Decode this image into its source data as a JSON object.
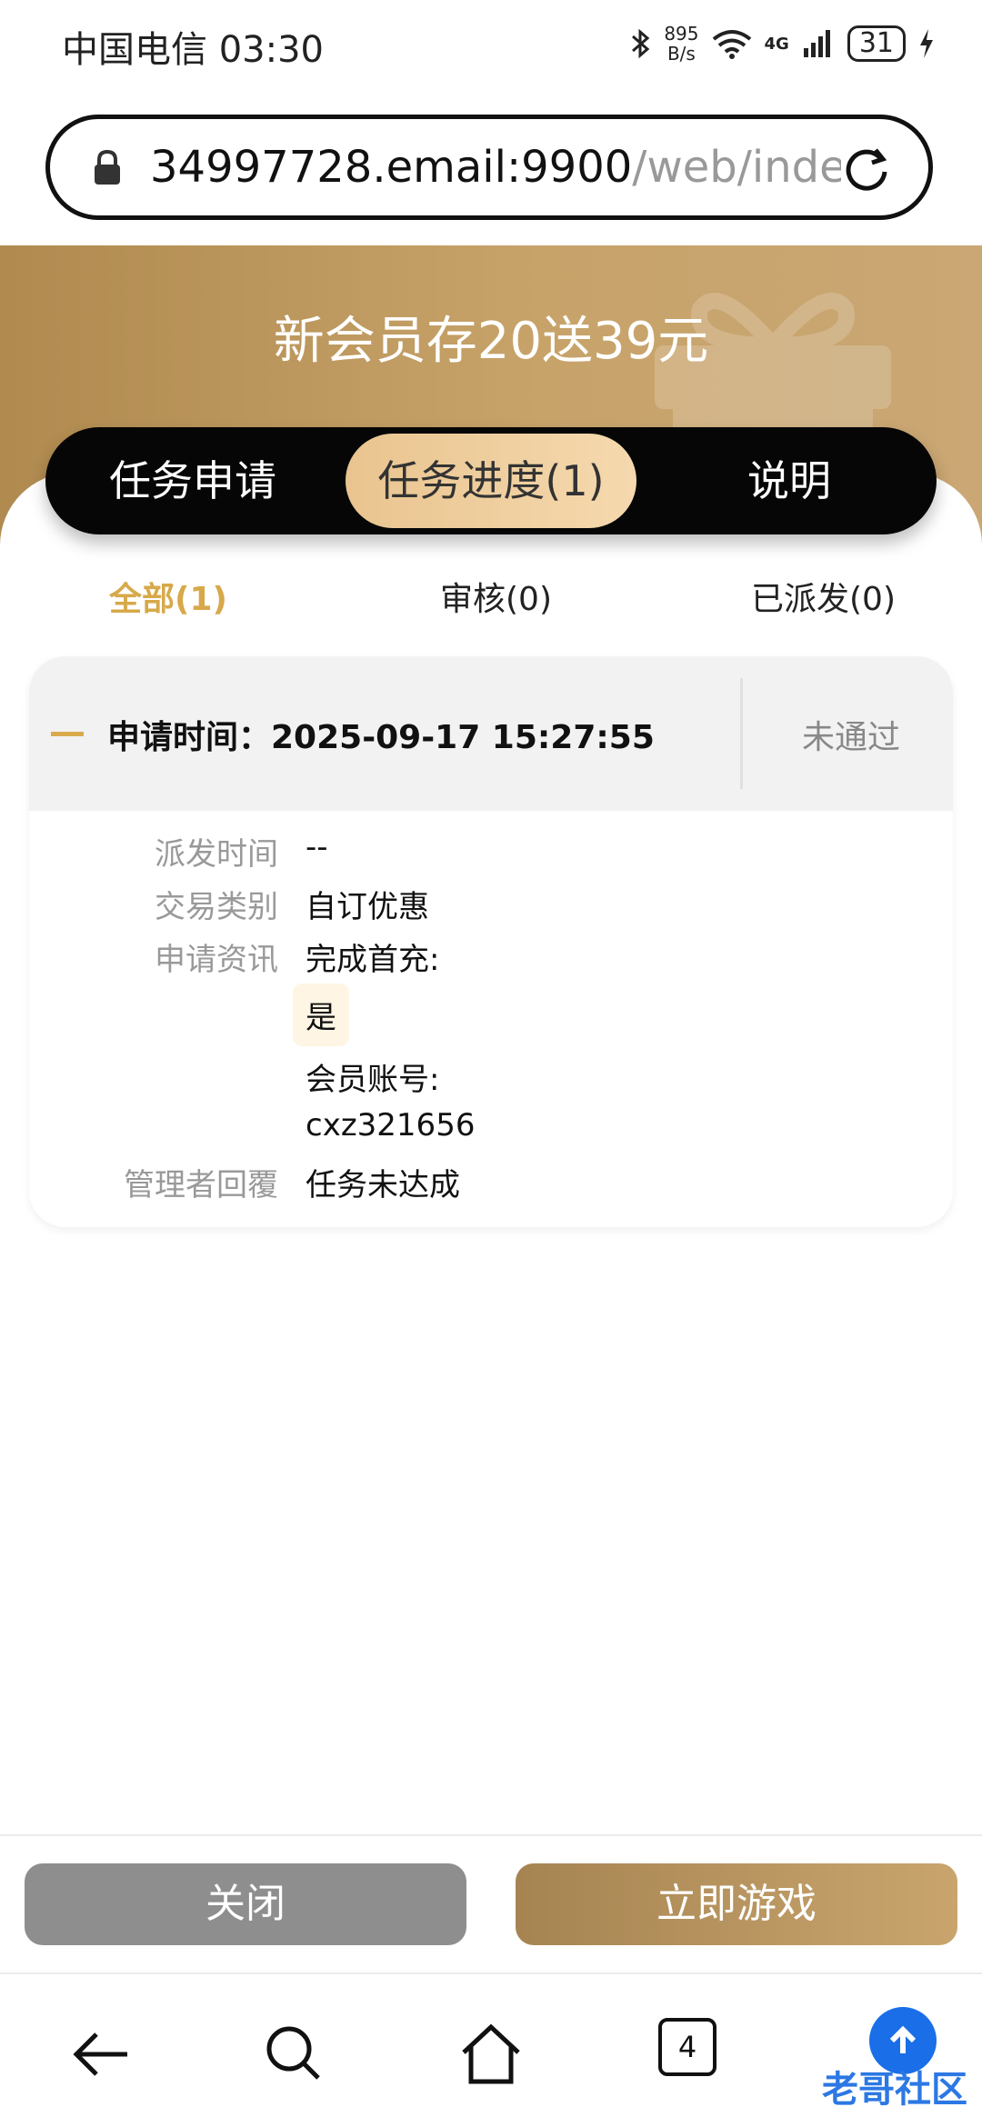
{
  "status_bar": {
    "carrier_time": "中国电信 03:30",
    "net_speed_value": "895",
    "net_speed_unit": "B/s",
    "network": "4G",
    "battery": "31"
  },
  "browser": {
    "url_host": "34997728.email:9900",
    "url_path": "/web/index.p"
  },
  "banner": {
    "title": "新会员存20送39元"
  },
  "main_tabs": [
    {
      "label": "任务申请"
    },
    {
      "label": "任务进度(1)"
    },
    {
      "label": "说明"
    }
  ],
  "sub_tabs": [
    {
      "label": "全部(1)"
    },
    {
      "label": "审核(0)"
    },
    {
      "label": "已派发(0)"
    }
  ],
  "record": {
    "apply_time": "申请时间：2025-09-17 15:27:55",
    "status": "未通过",
    "dispatch_time_label": "派发时间",
    "dispatch_time_value": "--",
    "type_label": "交易类别",
    "type_value": "自订优惠",
    "info_label": "申请资讯",
    "info_line1": "完成首充:",
    "info_chip": "是",
    "info_line2": "会员账号:",
    "info_line3": "cxz321656",
    "reply_label": "管理者回覆",
    "reply_value": "任务未达成"
  },
  "buttons": {
    "close": "关闭",
    "play": "立即游戏"
  },
  "nav": {
    "tab_count": "4",
    "watermark": "老哥社区"
  },
  "colors": {
    "accent_gold": "#d7a94a",
    "banner_gold": "#c7a36a",
    "active_tab": "#f5d9ae"
  }
}
